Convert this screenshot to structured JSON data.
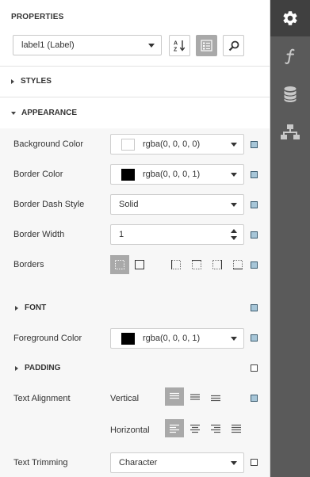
{
  "panel": {
    "title": "PROPERTIES",
    "object_selector": {
      "value": "label1 (Label)"
    }
  },
  "toolbar": {
    "sort_icon": "sort-alphabetical-icon",
    "categories_icon": "categorized-icon",
    "search_icon": "search-icon"
  },
  "sections": {
    "styles": "STYLES",
    "appearance": "APPEARANCE",
    "font": "FONT",
    "padding": "PADDING"
  },
  "properties": {
    "background_color": {
      "label": "Background Color",
      "value": "rgba(0, 0, 0, 0)",
      "swatch": "#ffffff"
    },
    "border_color": {
      "label": "Border Color",
      "value": "rgba(0, 0, 0, 1)",
      "swatch": "#000000"
    },
    "border_dash_style": {
      "label": "Border Dash Style",
      "value": "Solid"
    },
    "border_width": {
      "label": "Border Width",
      "value": "1"
    },
    "borders": {
      "label": "Borders"
    },
    "foreground_color": {
      "label": "Foreground Color",
      "value": "rgba(0, 0, 0, 1)",
      "swatch": "#000000"
    },
    "text_alignment": {
      "label": "Text Alignment",
      "vertical_label": "Vertical",
      "horizontal_label": "Horizontal"
    },
    "text_trimming": {
      "label": "Text Trimming",
      "value": "Character"
    }
  },
  "sidebar": {
    "items": [
      "gear-icon",
      "function-icon",
      "database-icon",
      "hierarchy-icon"
    ]
  },
  "colors": {
    "sidebar_bg": "#5a5a5a",
    "sidebar_active": "#404040",
    "active_button": "#a9a9a9",
    "marker_fill": "#a7c6d8",
    "appearance_bg": "#f7f7f7"
  }
}
